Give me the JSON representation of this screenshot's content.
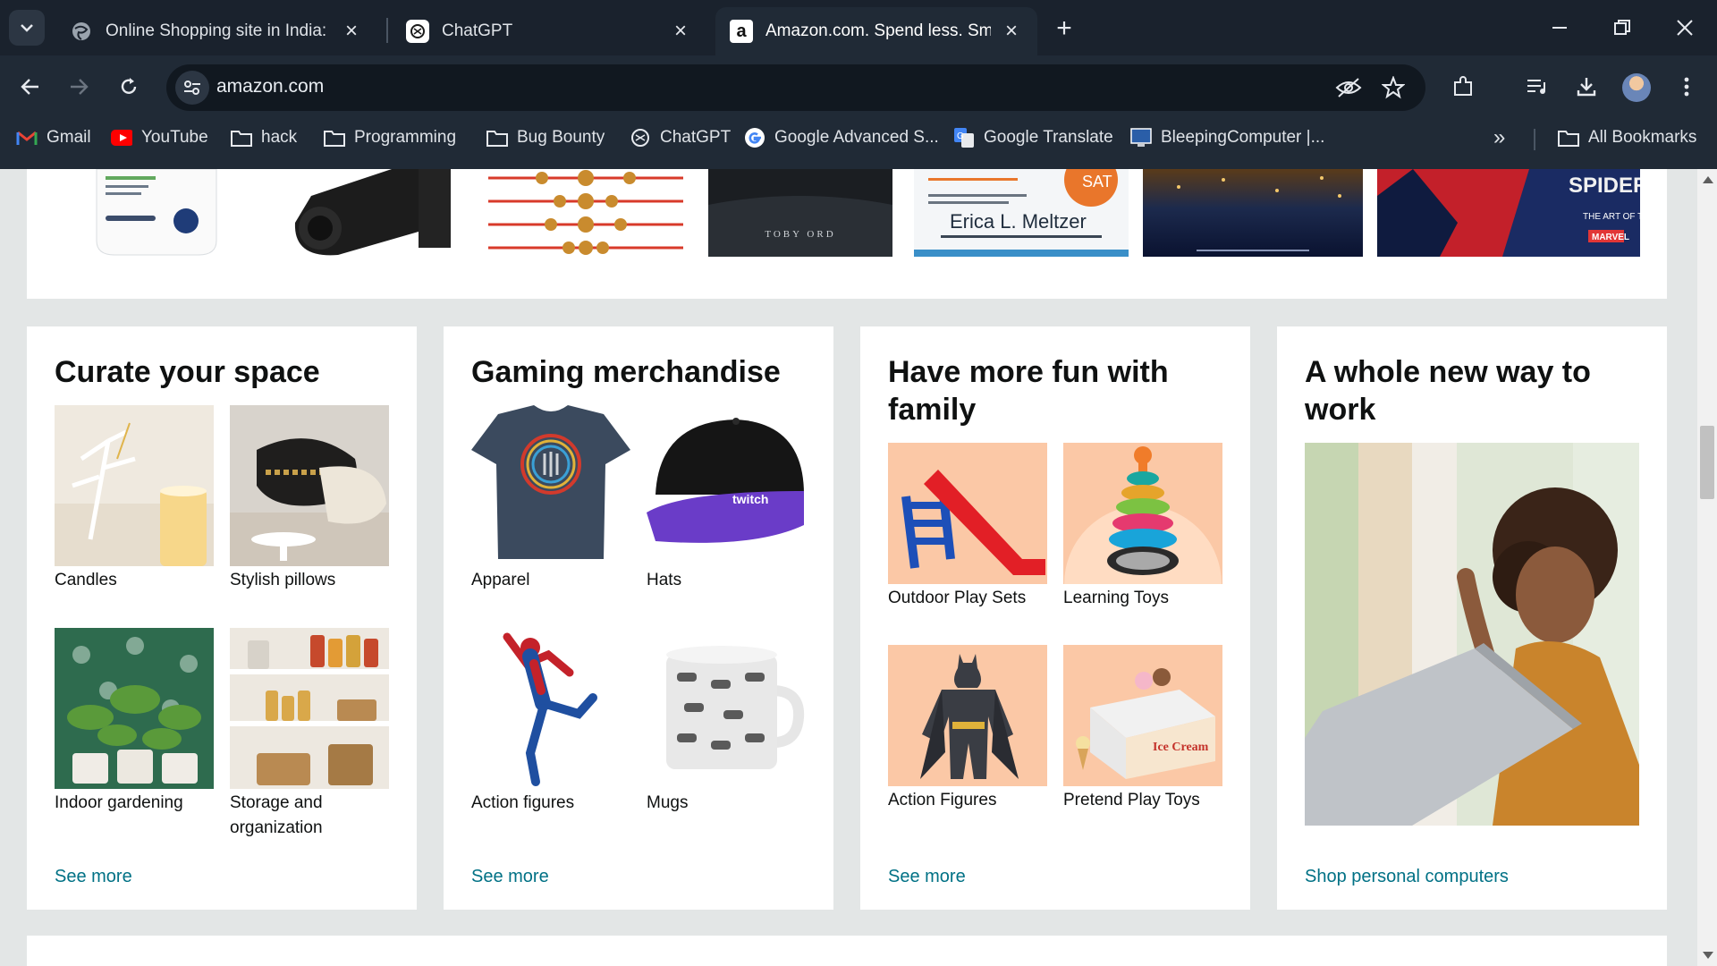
{
  "browser": {
    "tabs": [
      {
        "title": "Online Shopping site in India: Shop Online",
        "active": false
      },
      {
        "title": "ChatGPT",
        "active": false
      },
      {
        "title": "Amazon.com. Spend less. Smile more.",
        "active": true
      }
    ],
    "url": "amazon.com",
    "bookmarks": [
      "Gmail",
      "YouTube",
      "hack",
      "Programming",
      "Bug Bounty",
      "ChatGPT",
      "Google Advanced S...",
      "Google Translate",
      "BleepingComputer |...",
      "All Bookmarks"
    ]
  },
  "strip": {
    "items": [
      {
        "icon": "lotion-bottle-image"
      },
      {
        "icon": "black-device-image"
      },
      {
        "icon": "rakhi-bracelets-image"
      },
      {
        "icon": "book-cover-toby-ord",
        "text": "TOBY ORD"
      },
      {
        "icon": "sat-book-cover",
        "text": "Erica L. Meltzer"
      },
      {
        "icon": "ultimate-collectors-edition-cover"
      },
      {
        "icon": "spider-verse-art-book"
      }
    ]
  },
  "cards": [
    {
      "title": "Curate your space",
      "tiles": [
        "Candles",
        "Stylish pillows",
        "Indoor gardening",
        "Storage and organization"
      ],
      "link": "See more"
    },
    {
      "title": "Gaming merchandise",
      "tiles": [
        "Apparel",
        "Hats",
        "Action figures",
        "Mugs"
      ],
      "link": "See more"
    },
    {
      "title": "Have more fun with family",
      "tiles": [
        "Outdoor Play Sets",
        "Learning Toys",
        "Action Figures",
        "Pretend Play Toys"
      ],
      "link": "See more"
    },
    {
      "title": "A whole new way to work",
      "link": "Shop personal computers"
    }
  ],
  "colors": {
    "link": "#007185",
    "chrome_bg": "#202a36",
    "page_bg": "#e3e6e6"
  }
}
